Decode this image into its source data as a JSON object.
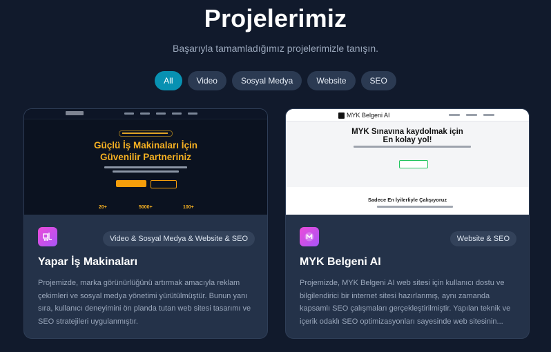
{
  "header": {
    "title": "Projelerimiz",
    "subtitle": "Başarıyla tamamladığımız projelerimizle tanışın."
  },
  "filters": [
    {
      "label": "All",
      "active": true
    },
    {
      "label": "Video",
      "active": false
    },
    {
      "label": "Sosyal Medya",
      "active": false
    },
    {
      "label": "Website",
      "active": false
    },
    {
      "label": "SEO",
      "active": false
    }
  ],
  "projects": [
    {
      "title": "Yapar İş Makinaları",
      "tags": "Video & Sosyal Medya & Website & SEO",
      "description": "Projemizde, marka görünürlüğünü artırmak amacıyla reklam çekimleri ve sosyal medya yönetimi yürütülmüştür. Bunun yanı sıra, kullanıcı deneyimini ön planda tutan web sitesi tasarımı ve SEO stratejileri uygulanmıştır.",
      "icon": "forklift-icon",
      "thumbnail": {
        "headline_line1": "Güçlü İş Makinaları İçin",
        "headline_line2": "Güvenilir Partneriniz",
        "stats": [
          "20+",
          "5000+",
          "100+"
        ]
      }
    },
    {
      "title": "MYK Belgeni AI",
      "tags": "Website & SEO",
      "description": "Projemizde, MYK Belgeni AI web sitesi için kullanıcı dostu ve bilgilendirici bir internet sitesi hazırlanmış, aynı zamanda kapsamlı SEO çalışmaları gerçekleştirilmiştir. Yapılan teknik ve içerik odaklı SEO optimizasyonları sayesinde web sitesinin...",
      "icon": "m-logo-icon",
      "thumbnail": {
        "brand": "MYK Belgeni AI",
        "headline_line1": "MYK Sınavına kaydolmak için",
        "headline_line2": "En kolay yol!",
        "section_title": "Sadece En İyilerliyle Çalışıyoruz"
      }
    }
  ],
  "colors": {
    "background": "#111a2c",
    "card": "#243249",
    "accent": "#0891b2",
    "icon_gradient_start": "#ec4bd9",
    "icon_gradient_end": "#a855f7",
    "thumb_gold": "#f5b022"
  }
}
